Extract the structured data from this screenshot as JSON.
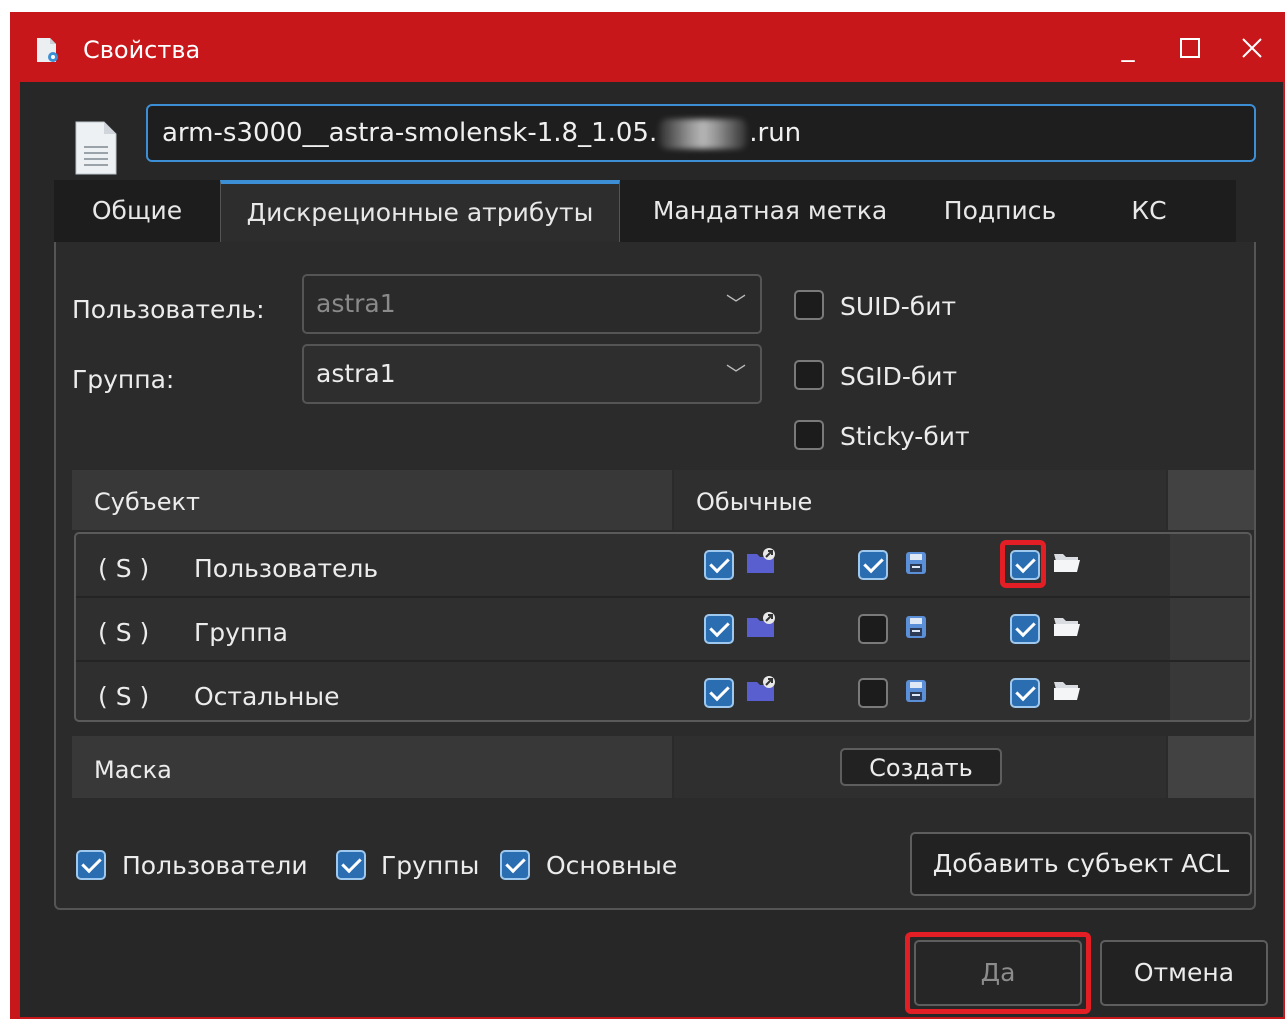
{
  "window": {
    "title": "Свойства"
  },
  "file": {
    "name_prefix": "arm-s3000__astra-smolensk-1.8_1.05.",
    "name_suffix": ".run"
  },
  "tabs": [
    "Общие",
    "Дискреционные атрибуты",
    "Мандатная метка",
    "Подпись",
    "КС"
  ],
  "owner": {
    "user_label": "Пользователь:",
    "user_value": "astra1",
    "group_label": "Группа:",
    "group_value": "astra1"
  },
  "flags": {
    "suid": "SUID-бит",
    "sgid": "SGID-бит",
    "sticky": "Sticky-бит"
  },
  "acl": {
    "col_subject": "Субъект",
    "col_normal": "Обычные",
    "rows": [
      {
        "type": "( S )",
        "name": "Пользователь",
        "read": true,
        "write": true,
        "exec": true
      },
      {
        "type": "( S )",
        "name": "Группа",
        "read": true,
        "write": false,
        "exec": true
      },
      {
        "type": "( S )",
        "name": "Остальные",
        "read": true,
        "write": false,
        "exec": true
      }
    ],
    "mask_label": "Маска",
    "create_button": "Создать"
  },
  "filters": {
    "users": "Пользователи",
    "groups": "Группы",
    "basic": "Основные"
  },
  "add_acl_button": "Добавить субъект ACL",
  "buttons": {
    "ok": "Да",
    "cancel": "Отмена"
  },
  "colors": {
    "accent": "#3c8fd5",
    "titlebar": "#c8171a",
    "highlight": "#e31e24",
    "window_bg": "#272727"
  }
}
